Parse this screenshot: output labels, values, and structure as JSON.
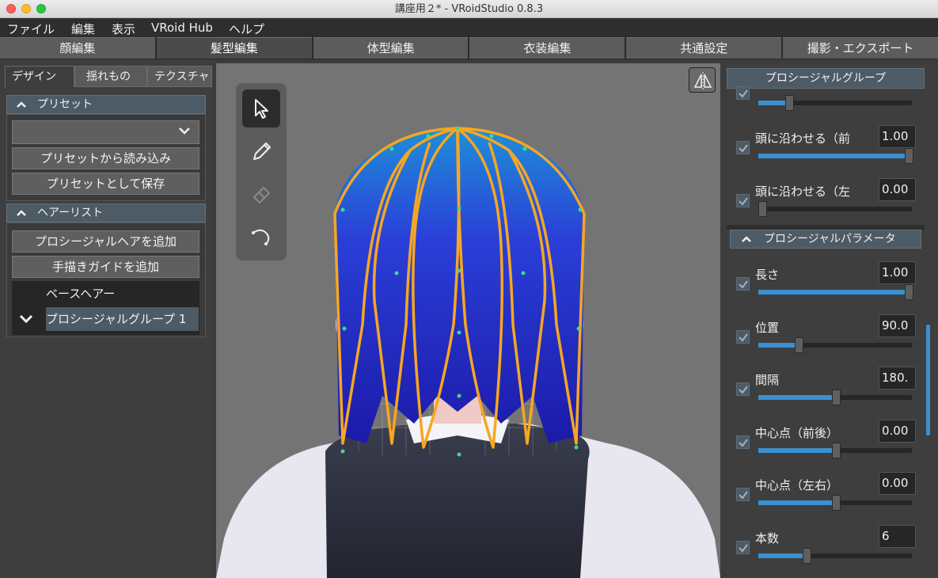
{
  "window": {
    "title": "講座用２* - VRoidStudio 0.8.3"
  },
  "menu": {
    "items": [
      "ファイル",
      "編集",
      "表示",
      "VRoid Hub",
      "ヘルプ"
    ]
  },
  "main_tabs": [
    "顔編集",
    "髪型編集",
    "体型編集",
    "衣装編集",
    "共通設定",
    "撮影・エクスポート"
  ],
  "left": {
    "subtabs": [
      "デザイン",
      "揺れもの",
      "テクスチャ"
    ],
    "preset": {
      "header": "プリセット",
      "load_label": "プリセットから読み込み",
      "save_label": "プリセットとして保存"
    },
    "hairlist": {
      "header": "ヘアーリスト",
      "add_procedural_label": "プロシージャルヘアを追加",
      "add_guide_label": "手描きガイドを追加",
      "items": [
        "ベースヘアー",
        "プロシージャルグループ 1"
      ]
    }
  },
  "right": {
    "header": "プロシージャルグループ",
    "params_top": [
      {
        "label": "頭に沿わせる（前",
        "value": "1.00",
        "fraction": 1.0
      },
      {
        "label": "頭に沿わせる（左",
        "value": "0.00",
        "fraction": 0.0
      }
    ],
    "section_header": "プロシージャルパラメータ",
    "params": [
      {
        "label": "長さ",
        "value": "1.00",
        "fraction": 1.0
      },
      {
        "label": "位置",
        "value": "90.0",
        "fraction": 0.25
      },
      {
        "label": "間隔",
        "value": "180.",
        "fraction": 0.5
      },
      {
        "label": "中心点（前後）",
        "value": "0.00",
        "fraction": 0.5
      },
      {
        "label": "中心点（左右）",
        "value": "0.00",
        "fraction": 0.5
      },
      {
        "label": "本数",
        "value": "6",
        "fraction": 0.3
      }
    ]
  },
  "colors": {
    "accent": "#3a8fd0",
    "selection": "#4d5b66",
    "hair_outline": "#f5a623",
    "control_point": "#3ddc84"
  },
  "icons": [
    "pointer-icon",
    "pencil-icon",
    "eraser-icon",
    "curve-icon",
    "mirror-icon",
    "chevron-down-icon",
    "chevron-up-icon",
    "check-icon"
  ]
}
